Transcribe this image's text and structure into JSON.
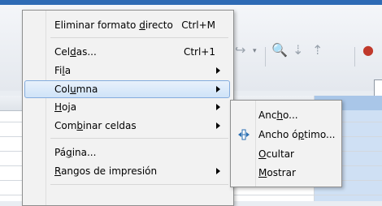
{
  "context_menu": {
    "items": [
      {
        "label_pre": "Eliminar formato ",
        "label_u": "d",
        "label_post": "irecto",
        "shortcut": "Ctrl+M"
      },
      {
        "label_pre": "Cel",
        "label_u": "d",
        "label_post": "as...",
        "shortcut": "Ctrl+1"
      },
      {
        "label_pre": "Fi",
        "label_u": "l",
        "label_post": "a"
      },
      {
        "label_pre": "Col",
        "label_u": "u",
        "label_post": "mna"
      },
      {
        "label_pre": "",
        "label_u": "H",
        "label_post": "oja"
      },
      {
        "label_pre": "Com",
        "label_u": "b",
        "label_post": "inar celdas"
      },
      {
        "label_pre": "Pá",
        "label_u": "g",
        "label_post": "ina..."
      },
      {
        "label_pre": "",
        "label_u": "R",
        "label_post": "angos de impresión"
      }
    ]
  },
  "submenu": {
    "items": [
      {
        "label_pre": "Anc",
        "label_u": "h",
        "label_post": "o..."
      },
      {
        "label_pre": "Ancho ó",
        "label_u": "p",
        "label_post": "timo..."
      },
      {
        "label_pre": "",
        "label_u": "O",
        "label_post": "cultar"
      },
      {
        "label_pre": "",
        "label_u": "M",
        "label_post": "ostrar"
      }
    ]
  },
  "colors": {
    "highlight": "#cfe3f8",
    "title_bar": "#2e6bb5",
    "selection": "#cfe0f4"
  }
}
